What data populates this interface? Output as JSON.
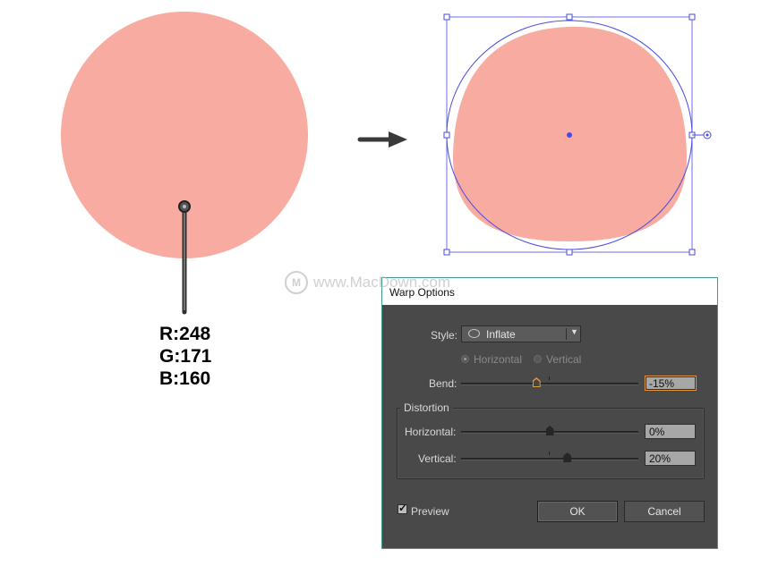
{
  "fill_color": "#F8ABA0",
  "selection_color": "#4A4AE0",
  "color_label": {
    "r": "R:248",
    "g": "G:171",
    "b": "B:160"
  },
  "watermark": {
    "logo": "M",
    "text": "www.MacDown.com"
  },
  "dialog": {
    "title": "Warp Options",
    "style_label": "Style:",
    "style_value": "Inflate",
    "orientation": {
      "horizontal_label": "Horizontal",
      "vertical_label": "Vertical",
      "selected": "horizontal"
    },
    "bend": {
      "label": "Bend:",
      "value": "-15%",
      "level": -15
    },
    "distortion": {
      "title": "Distortion",
      "horizontal_label": "Horizontal:",
      "horizontal_value": "0%",
      "horizontal_level": 0,
      "vertical_label": "Vertical:",
      "vertical_value": "20%",
      "vertical_level": 20
    },
    "preview": {
      "label": "Preview",
      "checked": true
    },
    "ok_label": "OK",
    "cancel_label": "Cancel"
  }
}
